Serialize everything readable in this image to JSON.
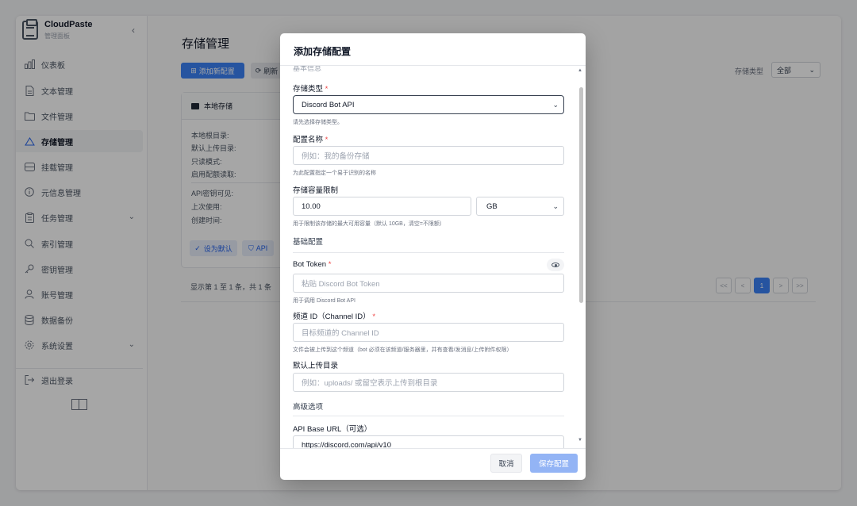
{
  "sidebar": {
    "brand_title": "CloudPaste",
    "brand_subtitle": "管理面板",
    "collapse_glyph": "‹",
    "items": [
      {
        "label": "仪表板"
      },
      {
        "label": "文本管理"
      },
      {
        "label": "文件管理"
      },
      {
        "label": "存储管理"
      },
      {
        "label": "挂载管理"
      },
      {
        "label": "元信息管理"
      },
      {
        "label": "任务管理"
      },
      {
        "label": "索引管理"
      },
      {
        "label": "密钥管理"
      },
      {
        "label": "账号管理"
      },
      {
        "label": "数据备份"
      },
      {
        "label": "系统设置"
      },
      {
        "label": "退出登录"
      }
    ]
  },
  "main": {
    "page_title": "存储管理",
    "add_button": "添加新配置",
    "refresh_button": "刷新",
    "filter_label": "存储类型",
    "filter_value": "全部",
    "card": {
      "title": "本地存储",
      "lines": [
        "本地根目录:",
        "默认上传目录:",
        "只读模式:",
        "启用配额读取:",
        "API密钥可见:",
        "上次使用:",
        "创建时间:"
      ],
      "set_default_button": "设为默认",
      "api_button": "API"
    },
    "pager_info": "显示第 1 至 1 条，共 1 条",
    "pager": [
      "<<",
      "<",
      "1",
      ">",
      ">>"
    ]
  },
  "modal": {
    "title": "添加存储配置",
    "cut_label": "基本信息",
    "storage_type_label": "存储类型",
    "storage_type_value": "Discord Bot API",
    "storage_type_hint": "请先选择存储类型。",
    "config_name_label": "配置名称",
    "config_name_placeholder": "例如：我的备份存储",
    "config_name_hint": "为此配置指定一个易于识别的名称",
    "quota_label": "存储容量限制",
    "quota_value": "10.00",
    "quota_unit": "GB",
    "quota_hint": "用于限制该存储的最大可用容量（默认 10GB，清空=不限额）",
    "basic_section": "基础配置",
    "bot_token_label": "Bot Token",
    "bot_token_placeholder": "粘贴 Discord Bot Token",
    "bot_token_hint": "用于调用 Discord Bot API",
    "channel_label": "频道 ID（Channel ID）",
    "channel_placeholder": "目标频道的 Channel ID",
    "channel_hint": "文件会被上传到这个频道（bot 必须在该频道/服务器里，并有查看/发消息/上传附件权限）",
    "upload_dir_label": "默认上传目录",
    "upload_dir_placeholder": "例如：uploads/ 或留空表示上传到根目录",
    "advanced_section": "高级选项",
    "api_base_label": "API Base URL（可选）",
    "api_base_value": "https://discord.com/api/v10",
    "cancel_button": "取消",
    "save_button": "保存配置",
    "required_mark": "*"
  }
}
